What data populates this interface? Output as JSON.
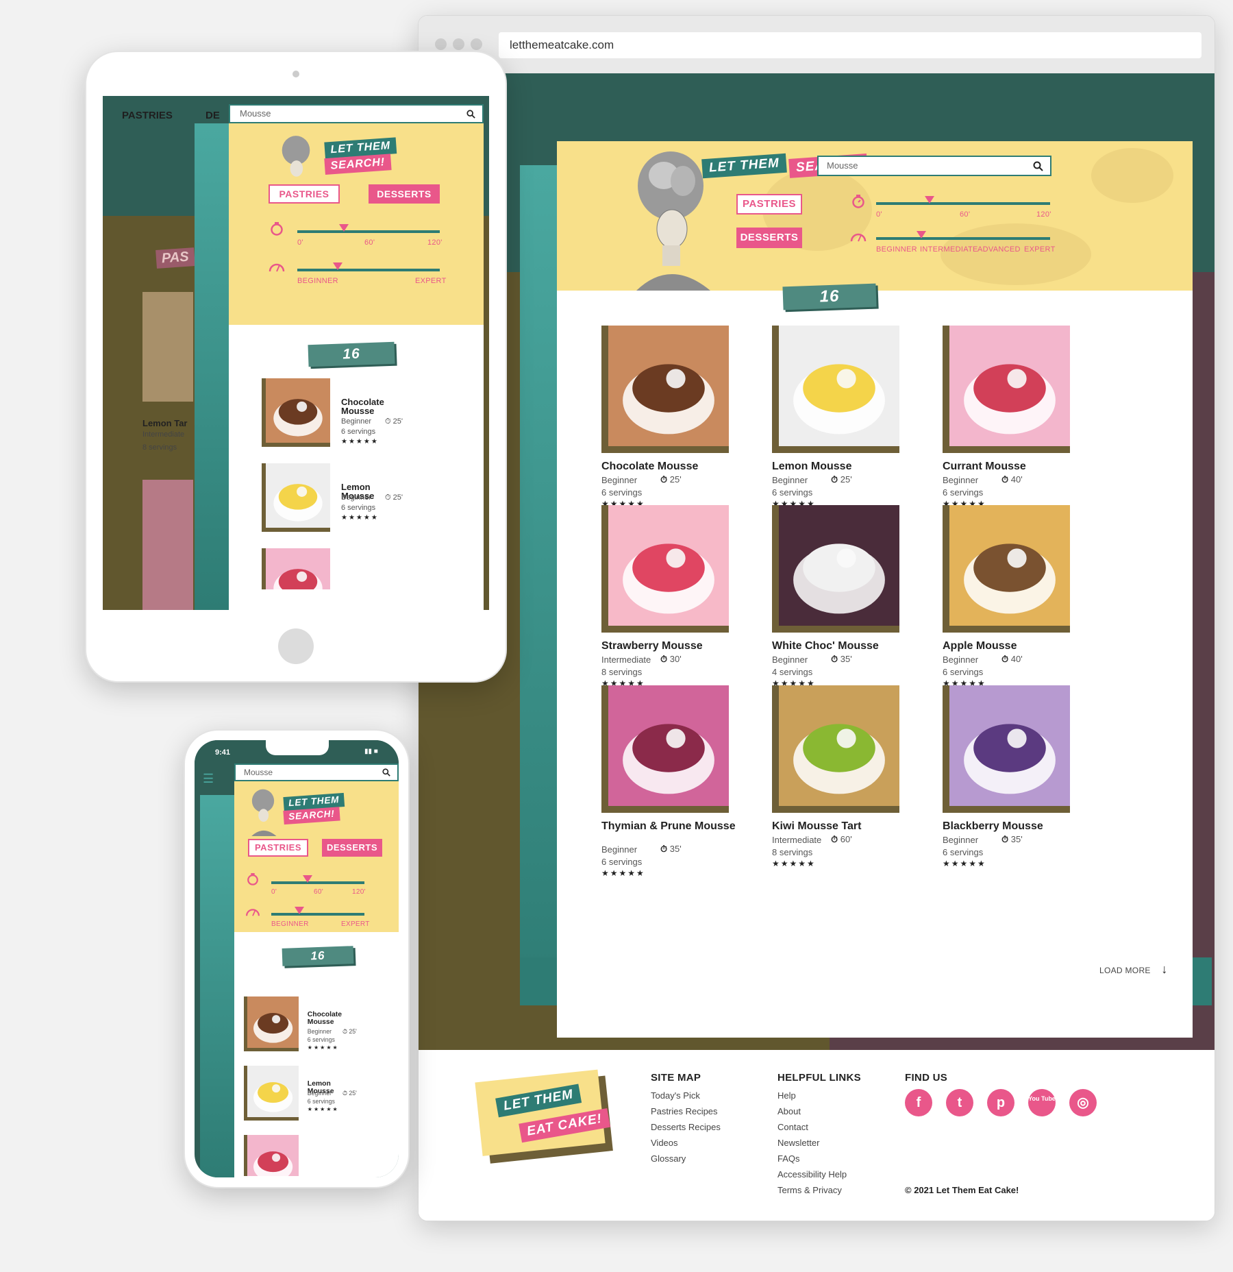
{
  "browser": {
    "url": "letthemeatcake.com"
  },
  "search": {
    "value": "Mousse",
    "slogan_1": "LET THEM",
    "slogan_2": "SEARCH!"
  },
  "filters": {
    "pastries": "PASTRIES",
    "desserts": "DESSERTS",
    "time_ticks": [
      "0'",
      "60'",
      "120'"
    ],
    "level_ticks": [
      "BEGINNER",
      "INTERMEDIATE",
      "ADVANCED",
      "EXPERT"
    ],
    "level_ticks_short": [
      "BEGINNER",
      "EXPERT"
    ],
    "time_value_min": 30,
    "level_value": "INTERMEDIATE"
  },
  "results": {
    "heading": "16 RESULTS",
    "load_more": "LOAD MORE",
    "items": [
      {
        "name": "Chocolate Mousse",
        "level": "Beginner",
        "time": "25'",
        "servings": "6 servings",
        "stars": "★★★★★"
      },
      {
        "name": "Lemon Mousse",
        "level": "Beginner",
        "time": "25'",
        "servings": "6 servings",
        "stars": "★★★★★"
      },
      {
        "name": "Currant Mousse",
        "level": "Beginner",
        "time": "40'",
        "servings": "6 servings",
        "stars": "★★★★★"
      },
      {
        "name": "Strawberry Mousse",
        "level": "Intermediate",
        "time": "30'",
        "servings": "8 servings",
        "stars": "★★★★★"
      },
      {
        "name": "White Choc' Mousse",
        "level": "Beginner",
        "time": "35'",
        "servings": "4 servings",
        "stars": "★★★★★"
      },
      {
        "name": "Apple Mousse",
        "level": "Beginner",
        "time": "40'",
        "servings": "6 servings",
        "stars": "★★★★★"
      },
      {
        "name": "Thymian & Prune Mousse",
        "level": "Beginner",
        "time": "35'",
        "servings": "6 servings",
        "stars": "★★★★★"
      },
      {
        "name": "Kiwi Mousse Tart",
        "level": "Intermediate",
        "time": "60'",
        "servings": "8 servings",
        "stars": "★★★★★"
      },
      {
        "name": "Blackberry Mousse",
        "level": "Beginner",
        "time": "35'",
        "servings": "6 servings",
        "stars": "★★★★★"
      }
    ]
  },
  "footer": {
    "logo_1": "LET THEM",
    "logo_2": "EAT CAKE!",
    "sitemap": {
      "title": "SITE MAP",
      "links": [
        "Today's Pick",
        "Pastries Recipes",
        "Desserts Recipes",
        "Videos",
        "Glossary"
      ]
    },
    "helpful": {
      "title": "HELPFUL LINKS",
      "links": [
        "Help",
        "About",
        "Contact",
        "Newsletter",
        "FAQs",
        "Accessibility Help",
        "Terms & Privacy"
      ]
    },
    "findus": {
      "title": "FIND US",
      "icons": [
        "facebook-icon",
        "twitter-icon",
        "pinterest-icon",
        "youtube-icon",
        "instagram-icon"
      ],
      "glyphs": [
        "f",
        "t",
        "p",
        "You Tube",
        "◎"
      ]
    },
    "copyright": "© 2021 Let Them Eat Cake!"
  },
  "tablet": {
    "nav": [
      "PASTRIES",
      "DE"
    ],
    "bg_card": "Lemon Tar",
    "bg_card_level": "Intermediate",
    "bg_card_servings": "8 servings",
    "bg_tag": "PAS"
  },
  "phone": {
    "time": "9:41"
  },
  "colors": {
    "teal": "#2e7c74",
    "pink": "#e9578a",
    "yellow": "#f8e08a",
    "olive": "#61572e",
    "plum": "#5a3f48"
  }
}
